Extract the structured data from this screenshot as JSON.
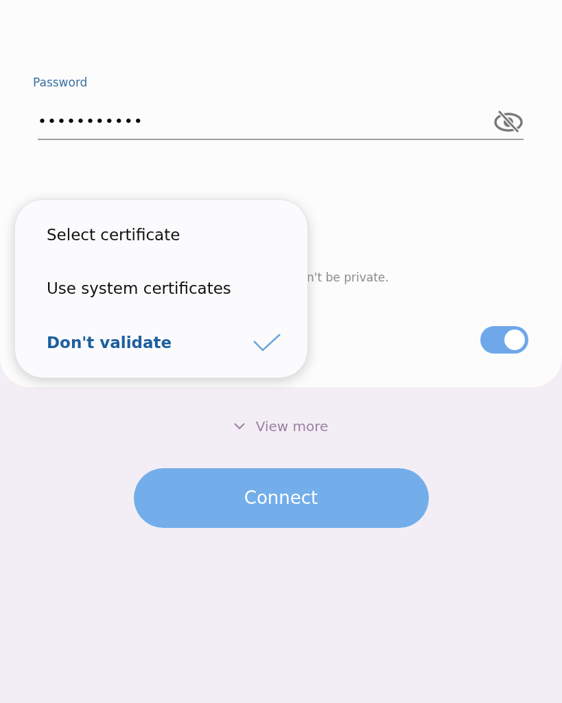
{
  "password": {
    "label": "Password",
    "value": "•••••••••••"
  },
  "partial_text": "n't be private.",
  "toggle": {
    "on": true
  },
  "menu": {
    "items": [
      {
        "label": "Select certificate",
        "selected": false
      },
      {
        "label": "Use system certificates",
        "selected": false
      },
      {
        "label": "Don't validate",
        "selected": true
      }
    ]
  },
  "view_more": {
    "label": "View more"
  },
  "connect_button": {
    "label": "Connect"
  }
}
